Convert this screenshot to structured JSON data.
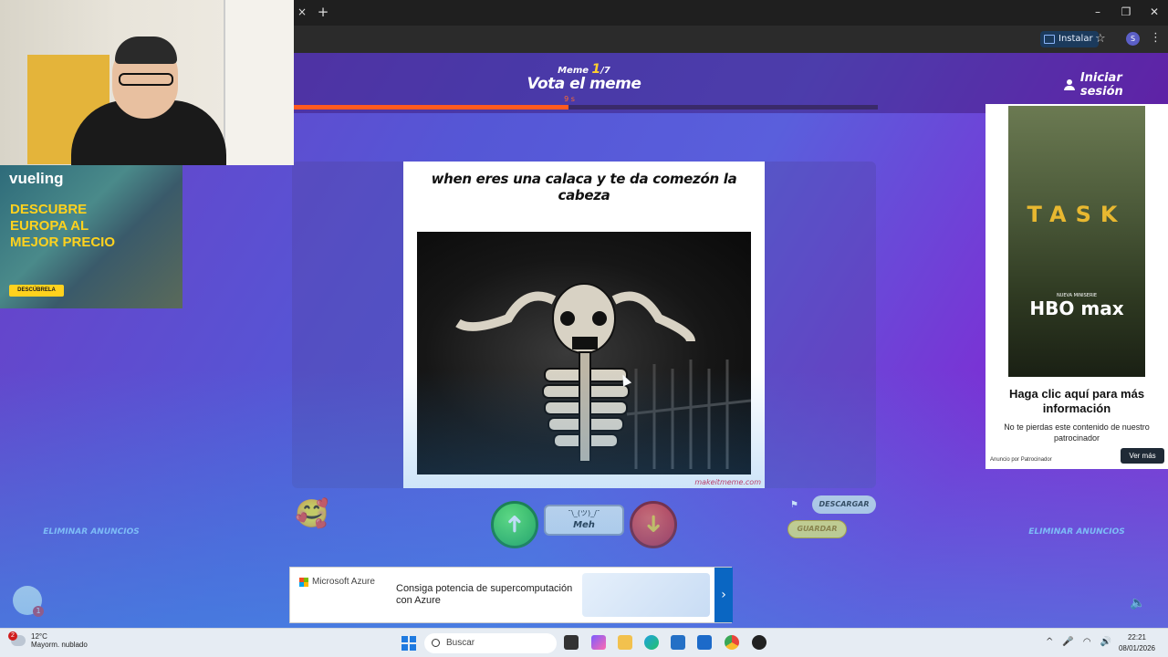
{
  "browser": {
    "tab_close": "×",
    "tab_new": "+",
    "install_label": "Instalar",
    "profile_initial": "S",
    "window_controls": [
      "–",
      "❐",
      "✕"
    ]
  },
  "header": {
    "meme_prefix": "Meme",
    "meme_current": "1",
    "meme_total": "/7",
    "title": "Vota el meme",
    "timer": "9 s",
    "timer_progress_pct": 47,
    "login_label": "Iniciar sesión"
  },
  "meme": {
    "caption": "when eres una calaca y te da comezón la cabeza",
    "watermark": "makeitmeme.com"
  },
  "voting": {
    "up_icon": "➜",
    "down_icon": "➜",
    "meh_face": "¯\\_(ツ)_/¯",
    "meh_label": "Meh",
    "emoji": "🥰",
    "download_label": "DESCARGAR",
    "save_label": "GUARDAR"
  },
  "ads": {
    "remove_ads_left": "ELIMINAR ANUNCIOS",
    "remove_ads_right": "ELIMINAR ANUNCIOS",
    "vueling": {
      "brand": "vueling",
      "slogan": "DESCUBRE EUROPA AL MEJOR PRECIO",
      "cta": "DESCÚBRELA"
    },
    "hbo": {
      "title": "TASK",
      "tagline": "NUEVA MINISERIE",
      "brand": "HBO max",
      "headline": "Haga clic aquí para más información",
      "body": "No te pierdas este contenido de nuestro patrocinador",
      "sponsor": "Anuncio por Patrocinador",
      "cta": "Ver más"
    },
    "azure": {
      "brand": "Microsoft Azure",
      "text": "Consiga potencia de supercomputación con Azure",
      "next": "›"
    }
  },
  "chat": {
    "badge": "1"
  },
  "taskbar": {
    "weather_temp": "12°C",
    "weather_desc": "Mayorm. nublado",
    "weather_badge": "2",
    "search_placeholder": "Buscar",
    "time": "22:21",
    "date": "08/01/2026"
  }
}
